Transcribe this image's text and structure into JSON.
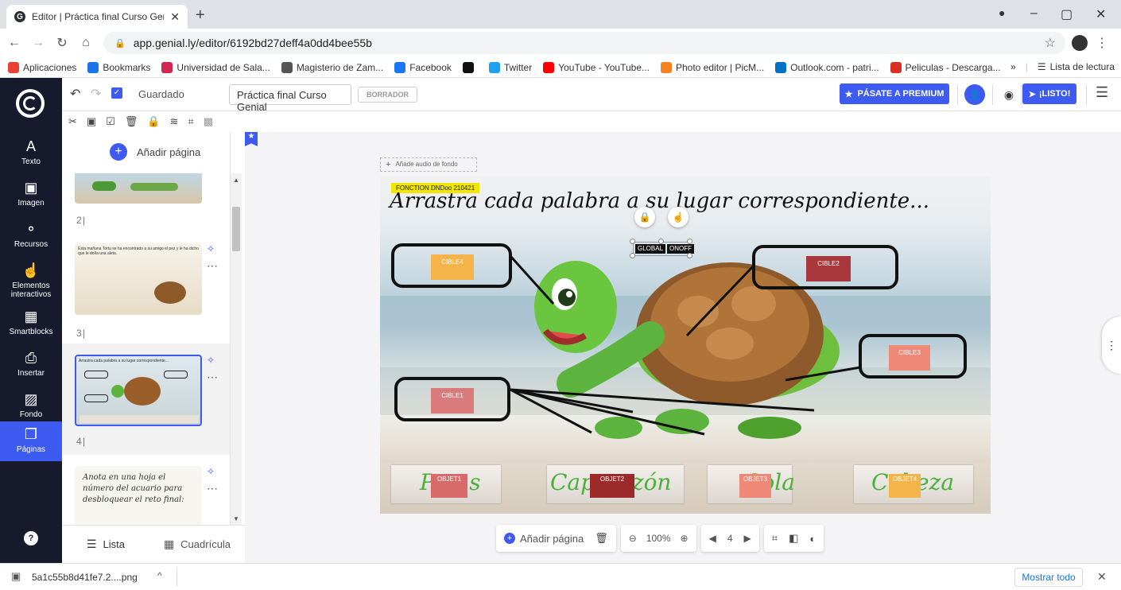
{
  "browser": {
    "tab_title": "Editor | Práctica final Curso Genia",
    "url": "app.genial.ly/editor/6192bd27deff4a0dd4bee55b",
    "bookmarks": [
      {
        "label": "Aplicaciones",
        "color": "#e94235"
      },
      {
        "label": "Bookmarks",
        "color": "#1a73e8"
      },
      {
        "label": "Universidad de Sala...",
        "color": "#d1264f"
      },
      {
        "label": "Magisterio de Zam...",
        "color": "#555555"
      },
      {
        "label": "Facebook",
        "color": "#1877f2"
      },
      {
        "label": "",
        "color": "#111111"
      },
      {
        "label": "Twitter",
        "color": "#1da1f2"
      },
      {
        "label": "YouTube - YouTube...",
        "color": "#ff0000"
      },
      {
        "label": "Photo editor | PicM...",
        "color": "#f58220"
      },
      {
        "label": "Outlook.com - patri...",
        "color": "#0072c6"
      },
      {
        "label": "Peliculas - Descarga...",
        "color": "#d93025"
      }
    ],
    "bookmarks_more": "»",
    "reading_list": "Lista de lectura"
  },
  "rail": {
    "items": [
      {
        "label": "Texto",
        "icon": "A"
      },
      {
        "label": "Imagen",
        "icon": "▣"
      },
      {
        "label": "Recursos",
        "icon": "⚬"
      },
      {
        "label": "Elementos interactivos",
        "icon": "☝"
      },
      {
        "label": "Smartblocks",
        "icon": "▦"
      },
      {
        "label": "Insertar",
        "icon": "⎙"
      },
      {
        "label": "Fondo",
        "icon": "▨"
      },
      {
        "label": "Páginas",
        "icon": "❐"
      }
    ],
    "help": "?"
  },
  "topbar": {
    "saved": "Guardado",
    "doc_title": "Práctica final Curso Genial",
    "draft": "BORRADOR",
    "premium": "PÁSATE A PREMIUM",
    "ready": "¡LISTO!"
  },
  "pages": {
    "add_page": "Añadir página",
    "items": [
      {
        "number": "2"
      },
      {
        "number": "3",
        "text": "Esta mañana Tortu se ha encontrado a su amigo el pez y le ha dicho que le dolía una aleta."
      },
      {
        "number": "4",
        "text": "Arrastra cada palabra a su lugar correspondiente..."
      },
      {
        "number": "",
        "text": "Anota en una hoja el número del acuario para desbloquear el reto final:"
      }
    ],
    "view_list": "Lista",
    "view_grid": "Cuadrícula"
  },
  "canvas": {
    "add_audio": "Añade audio de fondo",
    "tag": "FONCTION DNDoo 210421",
    "title": "Arrastra cada palabra a su lugar correspondiente...",
    "global_label": "GLOBAL",
    "onoff_label": "ONOFF",
    "targets": [
      {
        "label": "CIBLE4",
        "color": "#f4b44a"
      },
      {
        "label": "CIBLE2",
        "color": "#a8383c"
      },
      {
        "label": "CIBLE3",
        "color": "#ee8877"
      },
      {
        "label": "CIBLE1",
        "color": "#d97b7b"
      }
    ],
    "objects": [
      {
        "label": "OBJET1",
        "word": "Patas",
        "color": "#d96a6a"
      },
      {
        "label": "OBJET2",
        "word": "Caparazón",
        "color": "#9d2a2a"
      },
      {
        "label": "OBJET3",
        "word": "Cola",
        "color": "#ee8877"
      },
      {
        "label": "OBJET4",
        "word": "Cabeza",
        "color": "#f4b44a"
      }
    ]
  },
  "bottombar": {
    "add_page": "Añadir página",
    "zoom": "100%",
    "page": "4"
  },
  "download": {
    "file": "5a1c55b8d41fe7.2....png",
    "show_all": "Mostrar todo"
  }
}
